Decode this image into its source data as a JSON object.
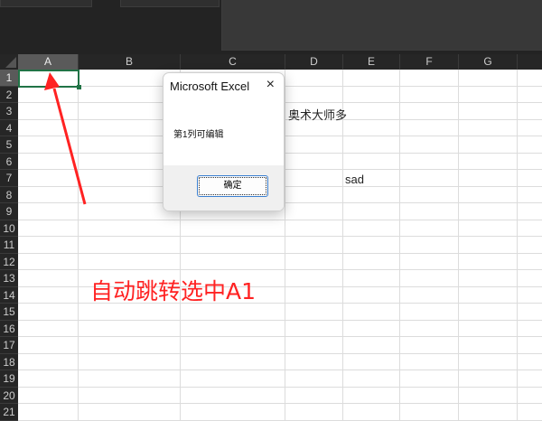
{
  "sheet": {
    "columns": [
      "A",
      "B",
      "C",
      "D",
      "E",
      "F",
      "G"
    ],
    "rows": [
      "1",
      "2",
      "3",
      "4",
      "5",
      "6",
      "7",
      "8",
      "9",
      "10",
      "11",
      "12",
      "13",
      "14",
      "15",
      "16",
      "17",
      "18",
      "19",
      "20",
      "21"
    ],
    "selected_cell": "A1",
    "cells": {
      "D3": "奥术大师多",
      "E7": "sad"
    }
  },
  "dialog": {
    "title": "Microsoft Excel",
    "close_icon": "×",
    "message": "第1列可编辑",
    "ok_label": "确定"
  },
  "annotation": {
    "text": "自动跳转选中A1",
    "color": "#ff2222"
  }
}
